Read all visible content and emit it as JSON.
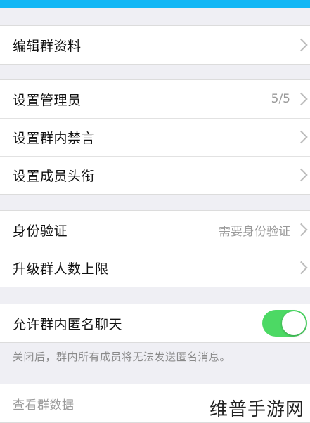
{
  "header": {
    "accent_color": "#12b7f5"
  },
  "group1": [
    {
      "label": "编辑群资料"
    }
  ],
  "group2": [
    {
      "label": "设置管理员",
      "value": "5/5"
    },
    {
      "label": "设置群内禁言"
    },
    {
      "label": "设置成员头衔"
    }
  ],
  "group3": [
    {
      "label": "身份验证",
      "value": "需要身份验证"
    },
    {
      "label": "升级群人数上限"
    }
  ],
  "group4": {
    "label": "允许群内匿名聊天",
    "toggle_on": true,
    "toggle_color": "#4cd964",
    "note": "关闭后，群内所有成员将无法发送匿名消息。"
  },
  "group5": [
    {
      "label": "查看群数据"
    }
  ],
  "watermark": "维普手游网"
}
